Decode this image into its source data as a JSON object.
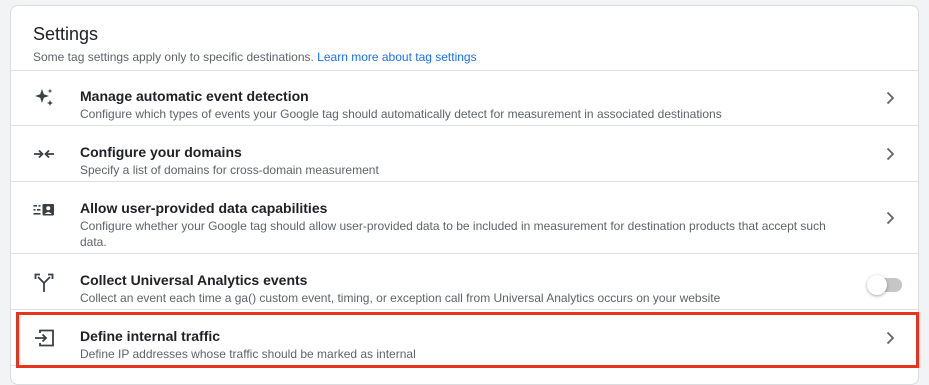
{
  "settings": {
    "title": "Settings",
    "subtitle": "Some tag settings apply only to specific destinations.",
    "learn_more": "Learn more about tag settings",
    "rows": [
      {
        "label": "Manage automatic event detection",
        "description": "Configure which types of events your Google tag should automatically detect for measurement in associated destinations",
        "icon": "sparkle-icon",
        "control": "chevron"
      },
      {
        "label": "Configure your domains",
        "description": "Specify a list of domains for cross-domain measurement",
        "icon": "merge-arrows-icon",
        "control": "chevron"
      },
      {
        "label": "Allow user-provided data capabilities",
        "description": "Configure whether your Google tag should allow user-provided data to be included in measurement for destination products that accept such data.",
        "icon": "user-data-icon",
        "control": "chevron"
      },
      {
        "label": "Collect Universal Analytics events",
        "description": "Collect an event each time a ga() custom event, timing, or exception call from Universal Analytics occurs on your website",
        "icon": "fork-arrow-icon",
        "control": "toggle",
        "toggle_on": false
      },
      {
        "label": "Define internal traffic",
        "description": "Define IP addresses whose traffic should be marked as internal",
        "icon": "input-arrow-icon",
        "control": "chevron",
        "highlighted": true
      }
    ]
  },
  "colors": {
    "link": "#1a73e8",
    "highlight_border": "#e8341c",
    "icon": "#5f6368"
  }
}
